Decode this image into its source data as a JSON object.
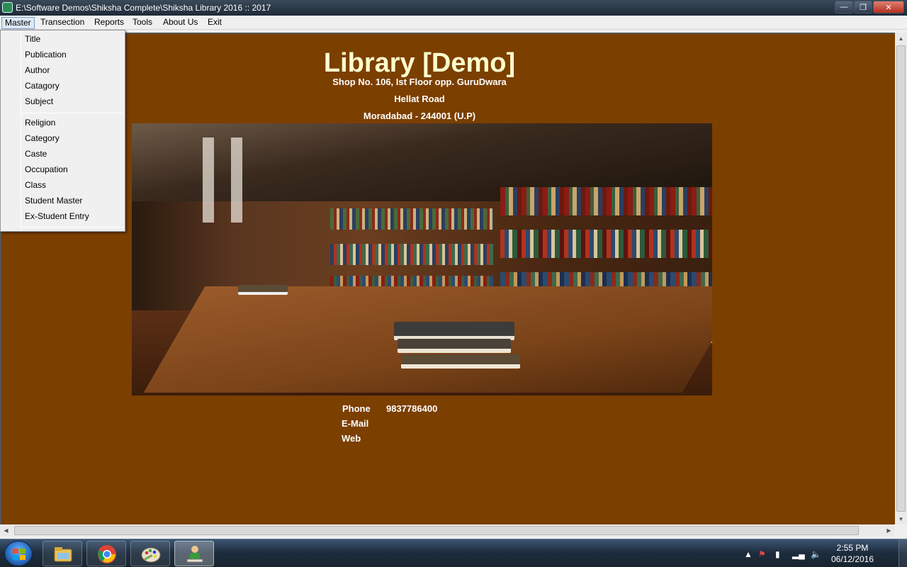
{
  "window": {
    "title": "E:\\Software Demos\\Shiksha Complete\\Shiksha Library 2016 :: 2017"
  },
  "menubar": {
    "items": [
      "Master",
      "Transection",
      "Reports",
      "Tools",
      "About Us",
      "Exit"
    ]
  },
  "dropdown": {
    "group1": [
      "Title",
      "Publication",
      "Author",
      "Catagory",
      "Subject"
    ],
    "group2": [
      "Religion",
      "Category",
      "Caste",
      "Occupation",
      "Class",
      "Student Master",
      "Ex-Student Entry"
    ]
  },
  "header": {
    "title": "Library [Demo]",
    "address_line1": "Shop No. 106, Ist Floor opp. GuruDwara",
    "address_line2": "Hellat Road",
    "address_line3": "Moradabad - 244001 (U.P)"
  },
  "contact": {
    "phone_label": "Phone",
    "phone_value": "9837786400",
    "email_label": "E-Mail",
    "web_label": "Web"
  },
  "taskbar": {
    "time": "2:55 PM",
    "date": "06/12/2016",
    "apps": [
      "file-explorer-icon",
      "chrome-icon",
      "paint-icon",
      "shiksha-app-icon"
    ]
  },
  "colors": {
    "background": "#7b3f00",
    "title_text": "#ffffcc"
  }
}
